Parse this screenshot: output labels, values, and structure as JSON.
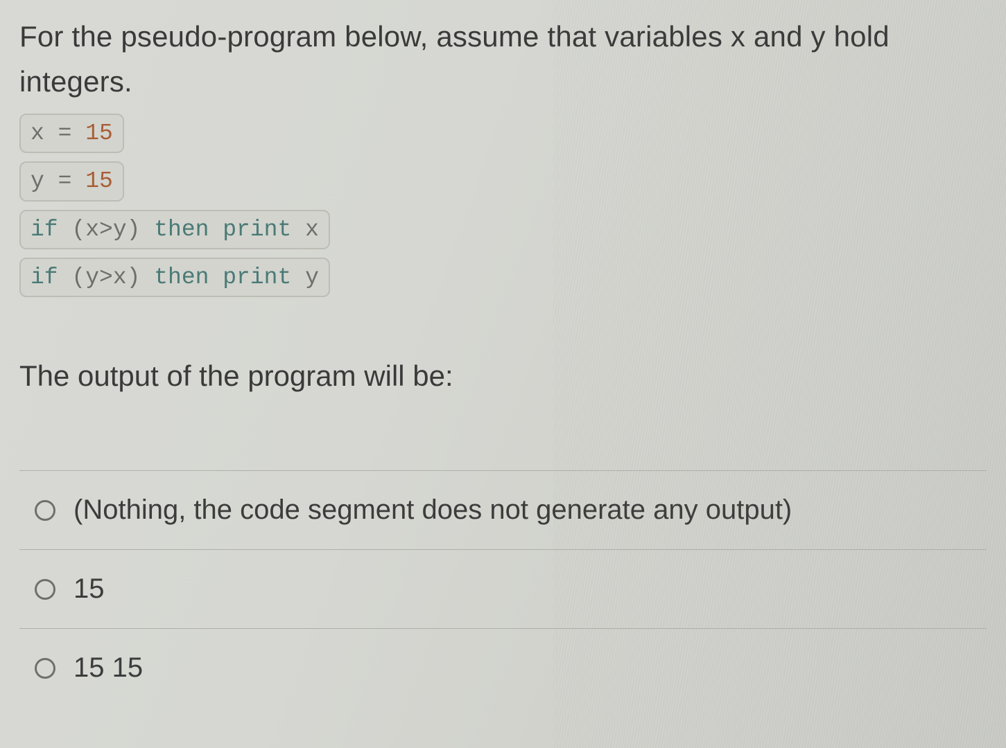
{
  "question": {
    "intro": "For the pseudo-program below, assume that variables x and y hold integers.",
    "prompt": "The output of the program will be:"
  },
  "code": {
    "line1_var": "x",
    "line1_eq": " = ",
    "line1_num": "15",
    "line2_var": "y",
    "line2_eq": " = ",
    "line2_num": "15",
    "line3_kw1": "if",
    "line3_expr": " (x>y) ",
    "line3_kw2": "then print",
    "line3_tail": " x",
    "line4_kw1": "if",
    "line4_expr": " (y>x) ",
    "line4_kw2": "then print",
    "line4_tail": " y"
  },
  "options": [
    {
      "label": "(Nothing, the code segment does not generate any output)"
    },
    {
      "label": "15"
    },
    {
      "label": "15 15"
    }
  ]
}
